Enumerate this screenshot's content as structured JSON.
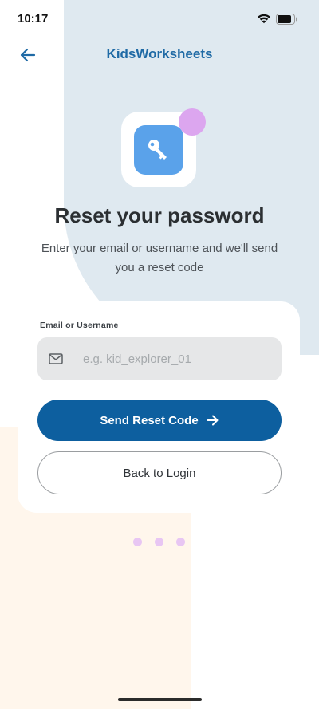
{
  "status_bar": {
    "time": "10:17"
  },
  "header": {
    "app_title": "KidsWorksheets"
  },
  "main": {
    "title": "Reset your password",
    "subtitle": "Enter your email or username and we'll send you a reset code",
    "field_label": "Email or Username",
    "input_placeholder": "e.g. kid_explorer_01",
    "input_value": "",
    "primary_button": "Send Reset Code",
    "secondary_button": "Back to Login"
  },
  "colors": {
    "accent": "#0d5f9f",
    "title_blue": "#1f6aa5",
    "key_tile": "#5aa2ea",
    "bg_blue": "#dfe9f0",
    "bg_cream": "#fff6ec",
    "purple_accent": "#dca6ef"
  },
  "icons": [
    "arrow-left-icon",
    "key-icon",
    "mail-icon",
    "arrow-right-icon",
    "wifi-icon",
    "battery-icon"
  ]
}
